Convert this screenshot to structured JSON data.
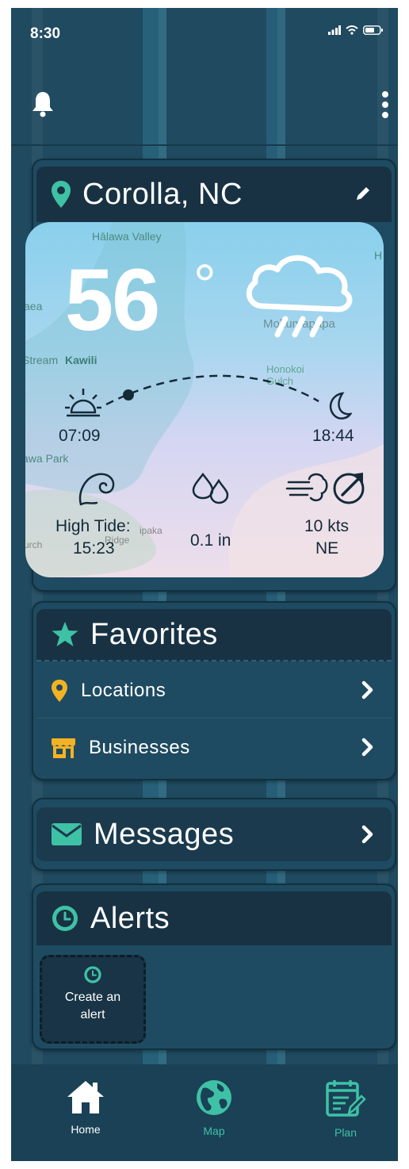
{
  "status_bar": {
    "time": "8:30"
  },
  "location_card": {
    "title": "Corolla, NC"
  },
  "weather": {
    "temperature": "56",
    "degree_symbol": "°",
    "sunrise": "07:09",
    "sunset": "18:44",
    "tide_label": "High Tide:",
    "tide_time": "15:23",
    "precipitation": "0.1 in",
    "wind_speed": "10 kts",
    "wind_direction": "NE",
    "map_labels": [
      "Hālawa Valley",
      "Mokumapapa",
      "Stream",
      "Kawili",
      "Honokoi Gulch",
      "aea",
      "awa Park",
      "Ridge",
      "ipaka",
      "urch",
      "H"
    ]
  },
  "favorites": {
    "title": "Favorites",
    "items": [
      {
        "label": "Locations"
      },
      {
        "label": "Businesses"
      }
    ]
  },
  "messages": {
    "title": "Messages"
  },
  "alerts": {
    "title": "Alerts",
    "create_label": "Create an alert"
  },
  "bottom_nav": {
    "items": [
      {
        "label": "Home"
      },
      {
        "label": "Map"
      },
      {
        "label": "Plan"
      }
    ]
  },
  "colors": {
    "background": "#1f4a60",
    "card_header": "#183243",
    "accent_teal": "#3fc1a6",
    "accent_yellow": "#f4b223",
    "nav_active": "#ffffff",
    "nav_inactive": "#3fc1a6"
  },
  "icons": {
    "header_left": "bell-icon",
    "header_right": "more-vertical-icon",
    "location": "map-pin-icon",
    "edit": "pencil-icon",
    "weather": "rain-cloud-icon",
    "sunrise": "sunrise-icon",
    "sunset": "moon-icon",
    "tide": "wave-icon",
    "precip": "droplets-icon",
    "wind": "wind-icon",
    "wind_dir": "compass-arrow-icon",
    "favorites": "star-icon",
    "locations": "map-pin-icon",
    "businesses": "store-icon",
    "messages": "envelope-icon",
    "alerts": "clock-icon",
    "home": "home-icon",
    "map": "globe-icon",
    "plan": "calendar-edit-icon"
  }
}
